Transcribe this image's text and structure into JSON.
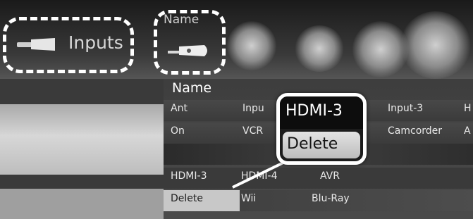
{
  "header": {
    "inputs_label": "Inputs",
    "name_caption": "Name",
    "inputs_icon": "input-plug-icon",
    "name_icon": "name-tag-icon"
  },
  "section": {
    "title": "Name"
  },
  "inputs_grid": {
    "row1": [
      "Ant",
      "Inpu",
      "Input-3",
      "H"
    ],
    "row2": [
      "On",
      "VCR",
      "Camcorder",
      "A"
    ],
    "row3": [
      "HDMI-3",
      "HDMI-4",
      "AVR"
    ],
    "row4": [
      "Delete",
      "Wii",
      "Blu-Ray"
    ]
  },
  "callout": {
    "selected_value": "HDMI-3",
    "option_label": "Delete"
  },
  "colors": {
    "highlight_border": "#ffffff",
    "selected_cell": "#c8c8c8"
  }
}
